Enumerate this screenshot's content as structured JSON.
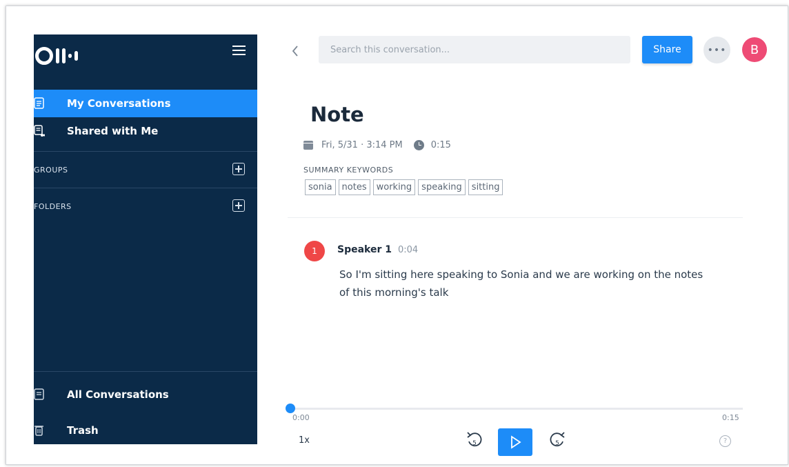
{
  "sidebar": {
    "nav": [
      {
        "label": "My Conversations",
        "active": true
      },
      {
        "label": "Shared with Me",
        "active": false
      }
    ],
    "sections": [
      {
        "title": "GROUPS"
      },
      {
        "title": "FOLDERS"
      }
    ],
    "bottom": [
      {
        "label": "All Conversations"
      },
      {
        "label": "Trash"
      }
    ]
  },
  "header": {
    "search_placeholder": "Search this conversation...",
    "share_label": "Share",
    "more_label": "•••",
    "avatar_initial": "B"
  },
  "note": {
    "title": "Note",
    "date": "Fri, 5/31 · 3:14 PM",
    "duration": "0:15",
    "keywords_label": "SUMMARY KEYWORDS",
    "keywords": [
      "sonia",
      "notes",
      "working",
      "speaking",
      "sitting"
    ]
  },
  "transcript": {
    "speaker_number": "1",
    "speaker_name": "Speaker 1",
    "timestamp": "0:04",
    "text": "So I'm sitting here speaking to Sonia and we are working on the notes of this morning's talk"
  },
  "player": {
    "current_time": "0:00",
    "total_time": "0:15",
    "speed": "1x",
    "rewind_seconds": "5",
    "forward_seconds": "5",
    "help_label": "?"
  },
  "colors": {
    "sidebar_bg": "#0b2a48",
    "accent": "#1d8cf8",
    "avatar": "#ee4b75",
    "speaker_badge": "#ef4747"
  }
}
